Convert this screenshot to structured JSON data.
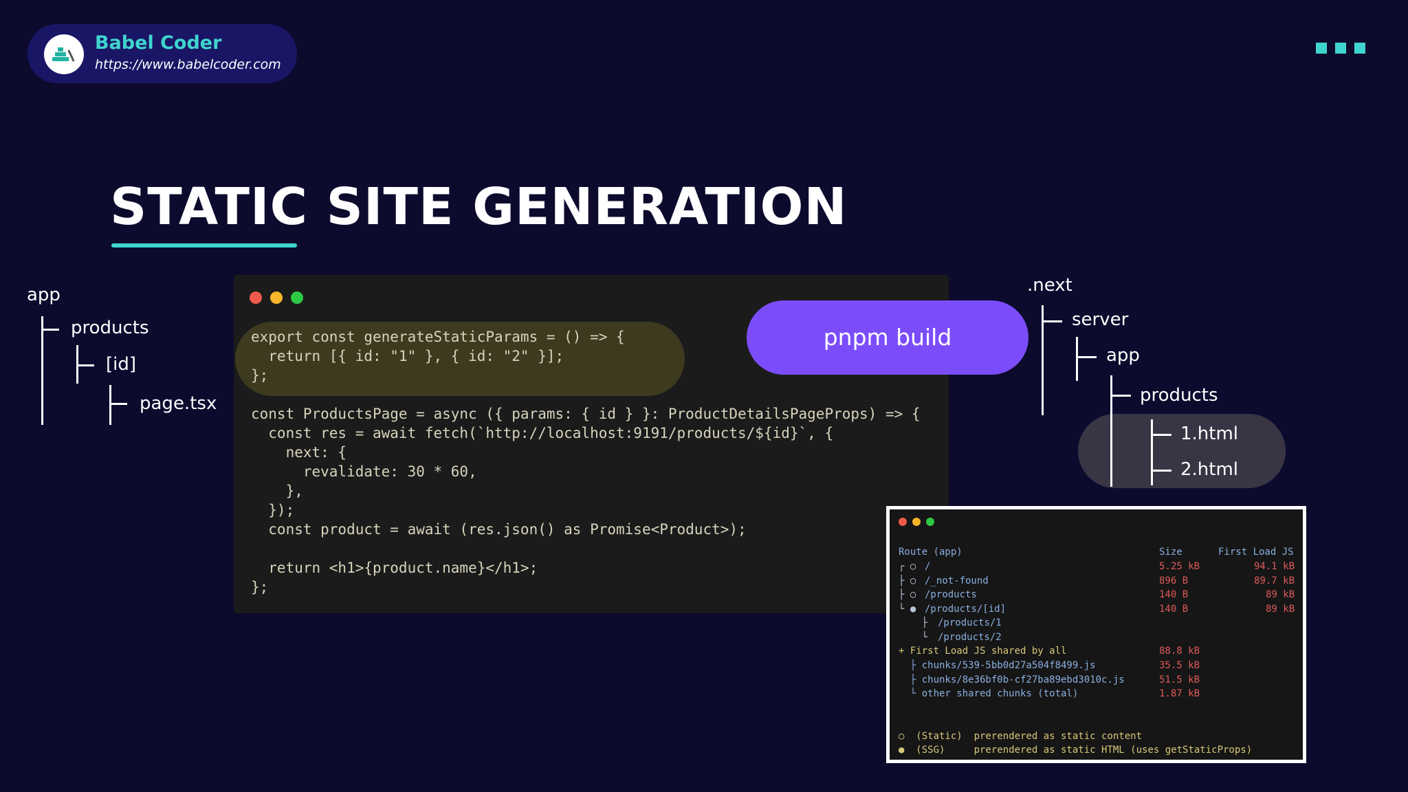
{
  "brand": {
    "name": "Babel Coder",
    "url": "https://www.babelcoder.com"
  },
  "title": "STATIC SITE GENERATION",
  "app_tree": {
    "root": "app",
    "products": "products",
    "id": "[id]",
    "page": "page.tsx"
  },
  "build_button": "pnpm build",
  "next_tree": {
    "root": ".next",
    "server": "server",
    "app": "app",
    "products": "products",
    "file1": "1.html",
    "file2": "2.html"
  },
  "code": {
    "l1": "export const generateStaticParams = () => {",
    "l2": "  return [{ id: \"1\" }, { id: \"2\" }];",
    "l3": "};",
    "l4": "const ProductsPage = async ({ params: { id } }: ProductDetailsPageProps) => {",
    "l5": "  const res = await fetch(`http://localhost:9191/products/${id}`, {",
    "l6": "    next: {",
    "l7": "      revalidate: 30 * 60,",
    "l8": "    },",
    "l9": "  });",
    "l10": "  const product = await (res.json() as Promise<Product>);",
    "l11": "  return <h1>{product.name}</h1>;",
    "l12": "};"
  },
  "terminal": {
    "header": {
      "route": "Route (app)",
      "size": "Size",
      "first_load": "First Load JS"
    },
    "rows": [
      {
        "prefix": "┌ ○ ",
        "route": "/",
        "size": "5.25 kB",
        "load": "94.1 kB"
      },
      {
        "prefix": "├ ○ ",
        "route": "/_not-found",
        "size": "896 B",
        "load": "89.7 kB"
      },
      {
        "prefix": "├ ○ ",
        "route": "/products",
        "size": "140 B",
        "load": "89 kB"
      },
      {
        "prefix": "└ ● ",
        "route": "/products/[id]",
        "size": "140 B",
        "load": "89 kB"
      },
      {
        "prefix": "    ├ ",
        "route": "/products/1",
        "size": "",
        "load": ""
      },
      {
        "prefix": "    └ ",
        "route": "/products/2",
        "size": "",
        "load": ""
      }
    ],
    "shared": {
      "label": "+ First Load JS shared by all",
      "size": "88.8 kB"
    },
    "chunks": [
      {
        "name": "  ├ chunks/539-5bb0d27a504f8499.js",
        "size": "35.5 kB"
      },
      {
        "name": "  ├ chunks/8e36bf0b-cf27ba89ebd3010c.js",
        "size": "51.5 kB"
      },
      {
        "name": "  └ other shared chunks (total)",
        "size": "1.87 kB"
      }
    ],
    "legend": [
      "○  (Static)  prerendered as static content",
      "●  (SSG)     prerendered as static HTML (uses getStaticProps)"
    ]
  },
  "colors": {
    "background": "#0c0b2e",
    "accent": "#3fd5ce",
    "pill": "#7b4dfa"
  }
}
